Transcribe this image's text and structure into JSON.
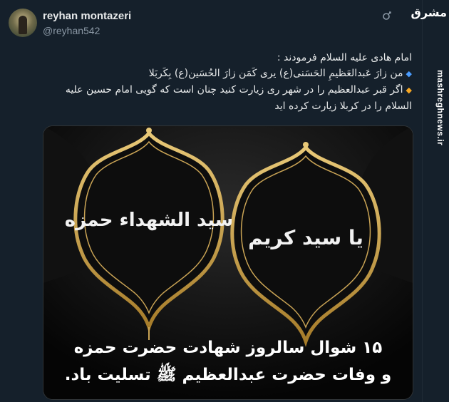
{
  "tweet": {
    "display_name": "reyhan montazeri",
    "handle": "@reyhan542",
    "lines": [
      "امام هادی علیه السلام  فرمودند :",
      "من زارَ عَبدالعَظیمِ الحَسَنی(ع) یری کَمَن زارَ الحُسَین(ع) بِکَربَلا",
      "اگر قبر عبدالعظیم را در شهر ری زیارت کنید چنان است که گویی امام حسین علیه",
      "السلام را در کربلا زیارت کرده اید"
    ],
    "image": {
      "calligraphy_left": "سید الشهداء حمزه",
      "calligraphy_right": "یا سید کریم",
      "caption_line1": "۱۵ شوال سالروز شهادت حضرت حمزه",
      "caption_line2": "و وفات حضرت عبدالعظیم ﷺ تسلیت باد."
    }
  },
  "sidebar": {
    "logo": "مشرق",
    "url": "mashreghnews.ir"
  },
  "colors": {
    "background": "#15202b",
    "gold": "#c9a24a",
    "blue_bullet": "#4a9cff",
    "orange_bullet": "#f5a623"
  },
  "icons": [
    "x-logo-icon",
    "blue-diamond-icon",
    "orange-diamond-icon"
  ]
}
